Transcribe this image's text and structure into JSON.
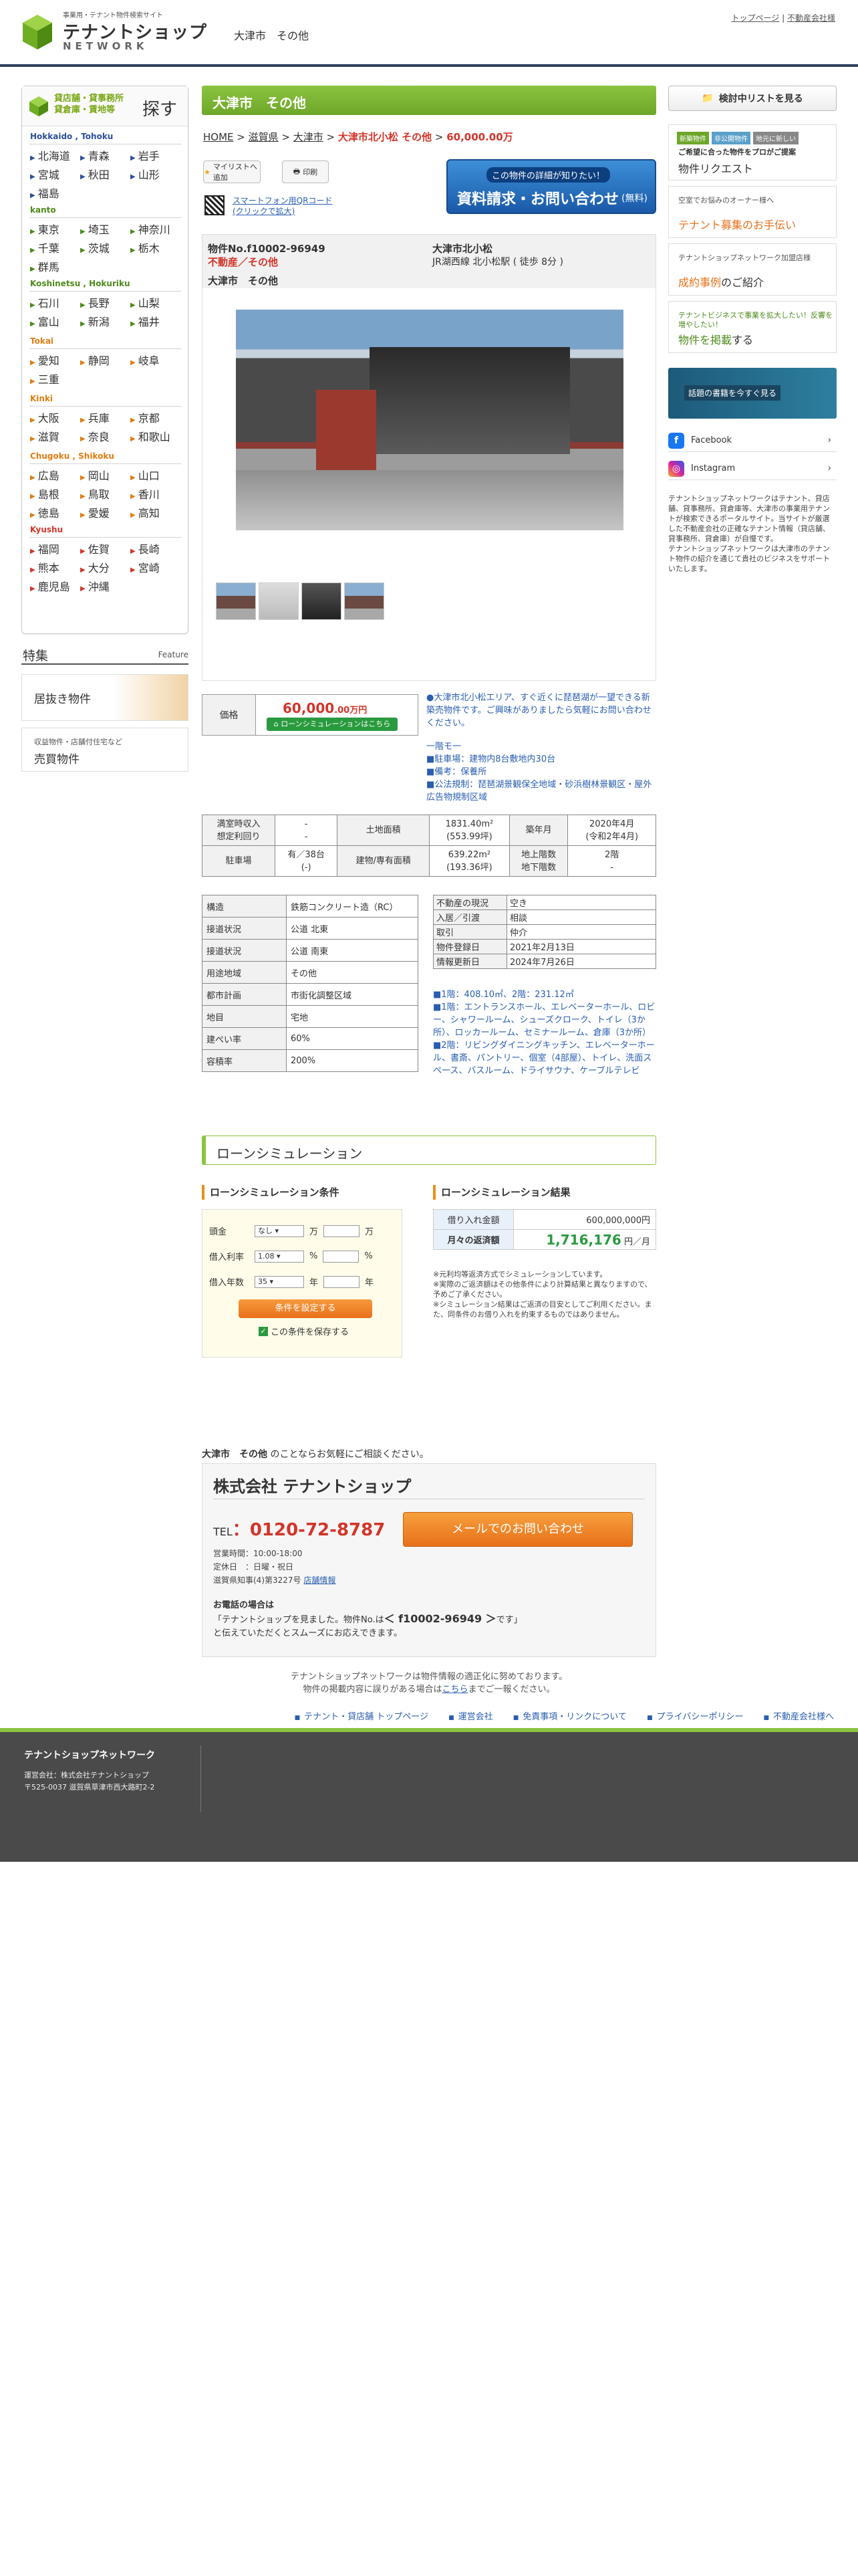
{
  "header": {
    "logo_sub": "事業用・テナント物件検索サイト",
    "logo_main": "テナントショップ",
    "logo_net": "NETWORK",
    "page_title": "大津市　その他",
    "link_top": "トップページ",
    "link_company": "不動産会社様"
  },
  "left": {
    "search_label_1": "貸店舗・貸事務所",
    "search_label_2": "貸倉庫・賃地等",
    "search_big": "探す",
    "regions": [
      {
        "name": "Hokkaido , Tohoku",
        "prefs": [
          "北海道",
          "青森",
          "岩手",
          "宮城",
          "秋田",
          "山形",
          "福島"
        ]
      },
      {
        "name": "kanto",
        "prefs": [
          "東京",
          "埼玉",
          "神奈川",
          "千葉",
          "茨城",
          "栃木",
          "群馬"
        ]
      },
      {
        "name": "Koshinetsu , Hokuriku",
        "prefs": [
          "石川",
          "長野",
          "山梨",
          "富山",
          "新潟",
          "福井"
        ]
      },
      {
        "name": "Tokai",
        "prefs": [
          "愛知",
          "静岡",
          "岐阜",
          "三重"
        ]
      },
      {
        "name": "Kinki",
        "prefs": [
          "大阪",
          "兵庫",
          "京都",
          "滋賀",
          "奈良",
          "和歌山"
        ]
      },
      {
        "name": "Chugoku , Shikoku",
        "prefs": [
          "広島",
          "岡山",
          "山口",
          "島根",
          "鳥取",
          "香川",
          "徳島",
          "愛媛",
          "高知"
        ]
      },
      {
        "name": "Kyushu",
        "prefs": [
          "福岡",
          "佐賀",
          "長崎",
          "熊本",
          "大分",
          "宮崎",
          "鹿児島",
          "沖縄"
        ]
      }
    ],
    "feature_title": "特集",
    "feature_en": "Feature",
    "feature_1": "居抜き物件",
    "feature_2_sub": "収益物件・店舗付住宅など",
    "feature_2": "売買物件"
  },
  "main": {
    "title": "大津市　その他",
    "breadcrumb": {
      "home": "HOME",
      "b1": "滋賀県",
      "b2": "大津市",
      "current": "大津市北小松 その他",
      "price": "60,000.00万"
    },
    "btn_favorite": "マイリストへ追加",
    "btn_print": "印刷",
    "qr_text_1": "スマートフォン用QRコード",
    "qr_text_2": "(クリックで拡大)",
    "request_top": "この物件の詳細が知りたい！",
    "request_main": "資料請求・お問い合わせ",
    "request_free": "(無料)",
    "property_no": "物件No.f10002-96949",
    "property_type": "不動産／その他",
    "property_cat": "大津市　その他",
    "address": "大津市北小松",
    "station": "JR湖西線 北小松駅 ( 徒歩 8分 )",
    "price_label": "価格",
    "price_value": "60,000",
    "price_decimal": ".00",
    "price_unit": "万円",
    "loan_button": "ローンシミュレーションはこちら",
    "description": "●大津市北小松エリア、すぐ近くに琵琶湖が一望できる新築売物件です。ご興味がありましたら気軽にお問い合わせください。",
    "features_head": "一階モ一",
    "features": [
      "■駐車場：建物内8台敷地内30台",
      "■備考：保養所",
      "■公法規制：琵琶湖景観保全地域・砂浜樹林景観区・屋外広告物規制区域"
    ]
  },
  "spec1": {
    "r1": [
      "満室時収入",
      "-",
      "土地面積",
      "1831.40m²",
      "築年月",
      "2020年4月"
    ],
    "r1b": [
      "想定利回り",
      "-",
      "",
      "(553.99坪)",
      "",
      "(令和2年4月)"
    ],
    "r2": [
      "駐車場",
      "有／38台",
      "建物/専有面積",
      "639.22m²",
      "地上階数",
      "2階"
    ],
    "r2b": [
      "",
      "(-)",
      "",
      "(193.36坪)",
      "地下階数",
      "-"
    ]
  },
  "spec2": [
    [
      "構造",
      "鉄筋コンクリート造（RC）"
    ],
    [
      "接道状況",
      "公道 北東"
    ],
    [
      "接道状況",
      "公道 南東"
    ],
    [
      "用途地域",
      "その他"
    ],
    [
      "都市計画",
      "市街化調整区域"
    ],
    [
      "地目",
      "宅地"
    ],
    [
      "建ぺい率",
      "60%"
    ],
    [
      "容積率",
      "200%"
    ]
  ],
  "spec3": [
    [
      "不動産の現況",
      "空き"
    ],
    [
      "入居／引渡",
      "相談"
    ],
    [
      "取引",
      "仲介"
    ],
    [
      "物件登録日",
      "2021年2月13日"
    ],
    [
      "情報更新日",
      "2024年7月26日"
    ]
  ],
  "floors": "■1階：408.10㎡、2階：231.12㎡\n■1階：エントランスホール、エレベーターホール、ロビー、シャワールーム、シューズクローク、トイレ（3か所）、ロッカールーム、セミナールーム、倉庫（3か所）\n■2階：リビングダイニングキッチン、エレベーターホール、書斎、パントリー、個室（4部屋）、トイレ、洗面スペース、バスルーム、ドライサウナ、ケーブルテレビ",
  "loan": {
    "title": "ローンシミュレーション",
    "cond_title": "ローンシミュレーション条件",
    "res_title": "ローンシミュレーション結果",
    "row1_label": "頭金",
    "row1_sel": "なし",
    "row1_unit1": "万",
    "row1_unit2": "万",
    "row2_label": "借入利率",
    "row2_sel": "1.08",
    "row2_unit1": "%",
    "row2_unit2": "%",
    "row3_label": "借入年数",
    "row3_sel": "35",
    "row3_unit1": "年",
    "row3_unit2": "年",
    "set_btn": "条件を設定する",
    "save": "この条件を保存する",
    "res_label_1": "借り入れ金額",
    "res_value_1": "600,000,000円",
    "res_label_2": "月々の返済額",
    "res_value_2": "1,716,176",
    "res_unit_2": "円／月",
    "notes": "※元利均等返済方式でシミュレーションしています。\n※実際のご返済額はその他条件により計算結果と異なりますので、予めご了承ください。\n※シミュレーション結果はご返済の目安としてご利用ください。また、同条件のお借り入れを約束するものではありません。"
  },
  "contact": {
    "intro_strong": "大津市　その他",
    "intro_rest": " のことならお気軽にご相談ください。",
    "company": "株式会社 テナントショップ",
    "tel_label": "TEL",
    "tel": "0120-72-8787",
    "mail_btn": "メールでのお問い合わせ",
    "hours": "営業時間：10:00-18:00",
    "holiday": "定休日　：日曜・祝日",
    "license": "滋賀県知事(4)第3227号",
    "store_info": "店舗情報",
    "call_head": "お電話の場合は",
    "call_line_a": "「テナントショップを見ました。物件No.は",
    "call_no": "＜ f10002-96949 ＞",
    "call_line_b": "です」",
    "call_line_c": "と伝えていただくとスムーズにお応えできます。"
  },
  "disclaimer_1": "テナントショップネットワークは物件情報の適正化に努めております。",
  "disclaimer_2a": "物件の掲載内容に誤りがある場合は",
  "disclaimer_link": "こちら",
  "disclaimer_2b": "までご一報ください。",
  "right": {
    "kentou": "検討中リストを見る",
    "tags": [
      "新築物件",
      "非公開物件",
      "地元に新しい"
    ],
    "card1_sub": "ご希望に合った物件をプロがご提案",
    "card1_main": "物件リクエスト",
    "card2_sub": "空室でお悩みのオーナー様へ",
    "card2_main": "テナント募集のお手伝い",
    "card3_sub": "テナントショップネットワーク加盟店様",
    "card3_main": "成約事例",
    "card3_rest": "のご紹介",
    "card4_sub": "テナントビジネスで事業を拡大したい！反響を増やしたい！",
    "card4_main": "物件を掲載",
    "card4_rest": "する",
    "banner": "話題の書籍を今すぐ見る",
    "facebook": "Facebook",
    "instagram": "Instagram",
    "text": "テナントショップネットワークはテナント、貸店舗、貸事務所、貸倉庫等、大津市の事業用テナントが検索できるポータルサイト。当サイトが厳選した不動産会社の正確なテナント情報（貸店舗、貸事務所、貸倉庫）が自慢です。\nテナントショップネットワークは大津市のテナント物件の紹介を通じて貴社のビジネスをサポートいたします。"
  },
  "footer": {
    "links": [
      "テナント・貸店舗 トップページ",
      "運営会社",
      "免責事項・リンクについて",
      "プライバシーポリシー",
      "不動産会社様へ"
    ],
    "name": "テナントショップネットワーク",
    "info_1": "運営会社：株式会社テナントショップ",
    "info_2": "〒525-0037 滋賀県草津市西大路町2-2"
  },
  "colors": {
    "accent_green": "#8bc43f",
    "price_red": "#d2352a",
    "link_blue": "#2a5db0",
    "cta_orange": "#e8701a"
  }
}
